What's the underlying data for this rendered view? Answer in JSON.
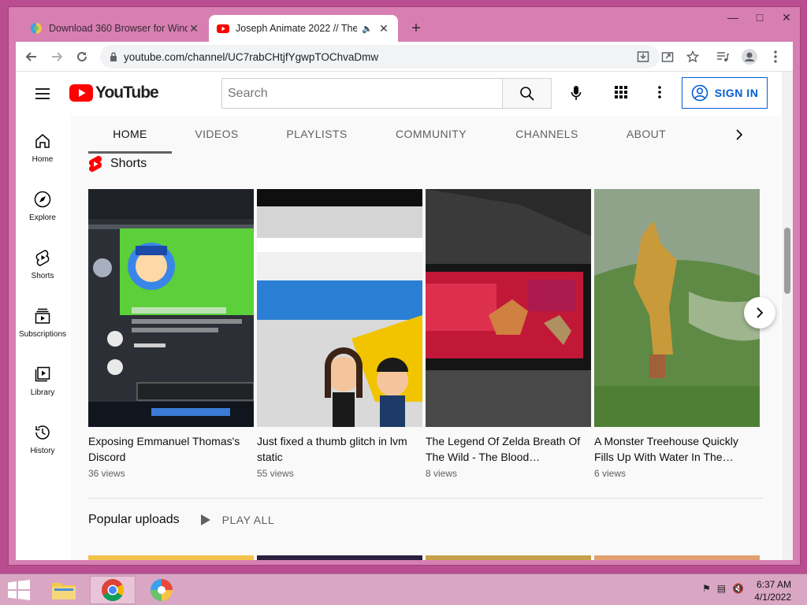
{
  "browser": {
    "tabs": [
      {
        "title": "Download 360 Browser for Wind",
        "active": false
      },
      {
        "title": "Joseph Animate 2022 // The",
        "active": true
      }
    ],
    "new_tab_label": "+",
    "url": "youtube.com/channel/UC7rabCHtjfYgwpTOChvaDmw"
  },
  "youtube": {
    "logo_text": "YouTube",
    "search_placeholder": "Search",
    "sign_in_label": "SIGN IN",
    "sidebar": [
      {
        "label": "Home",
        "icon": "home-icon"
      },
      {
        "label": "Explore",
        "icon": "compass-icon"
      },
      {
        "label": "Shorts",
        "icon": "shorts-icon"
      },
      {
        "label": "Subscriptions",
        "icon": "subscriptions-icon"
      },
      {
        "label": "Library",
        "icon": "library-icon"
      },
      {
        "label": "History",
        "icon": "history-icon"
      }
    ],
    "channel_tabs": [
      "HOME",
      "VIDEOS",
      "PLAYLISTS",
      "COMMUNITY",
      "CHANNELS",
      "ABOUT"
    ],
    "shorts_title": "Shorts",
    "shorts": [
      {
        "title": "Exposing Emmanuel Thomas's Discord",
        "views": "36 views"
      },
      {
        "title": "Just fixed a thumb glitch in lvm static",
        "views": "55 views"
      },
      {
        "title": "The Legend Of Zelda Breath Of The Wild - The Blood…",
        "views": "8 views"
      },
      {
        "title": "A Monster Treehouse Quickly Fills Up With Water In The…",
        "views": "6 views"
      }
    ],
    "popular_title": "Popular uploads",
    "play_all_label": "PLAY ALL"
  },
  "taskbar": {
    "time": "6:37 AM",
    "date": "4/1/2022"
  },
  "colors": {
    "yt_red": "#ff0000",
    "link_blue": "#065fd4",
    "window_frame": "#d77fb3"
  }
}
